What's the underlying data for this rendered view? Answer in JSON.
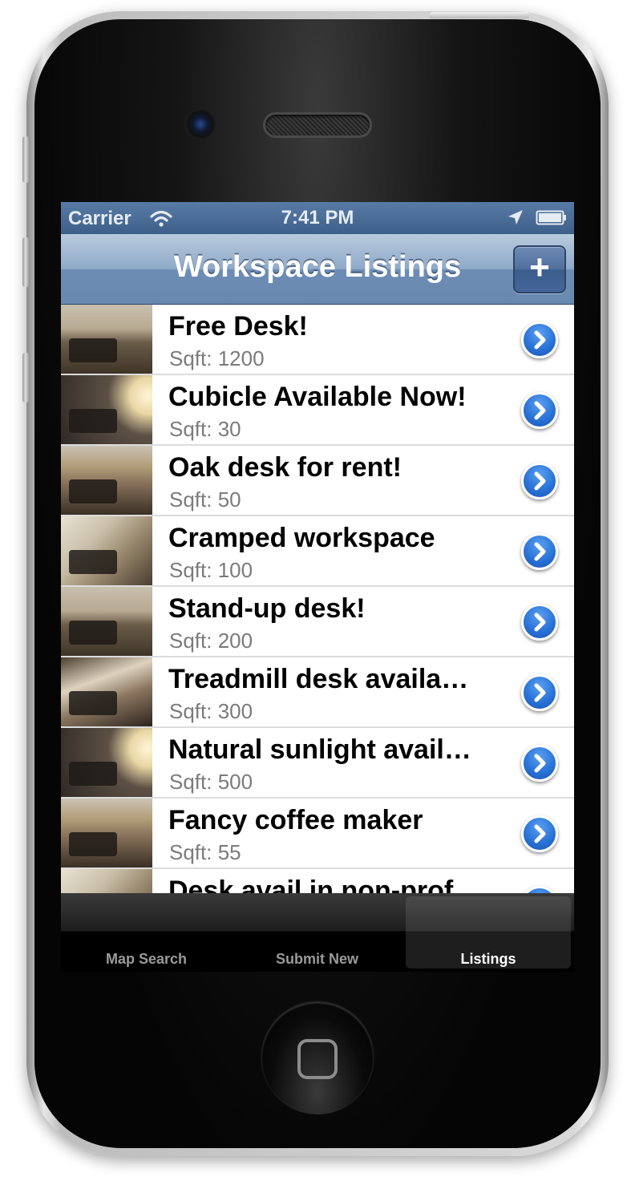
{
  "status_bar": {
    "carrier": "Carrier",
    "time": "7:41 PM",
    "icons": [
      "wifi-icon",
      "location-arrow-icon",
      "battery-icon"
    ]
  },
  "nav": {
    "title": "Workspace Listings",
    "add_label": "+"
  },
  "listings": [
    {
      "title": "Free Desk!",
      "subtitle": "Sqft: 1200"
    },
    {
      "title": "Cubicle Available Now!",
      "subtitle": "Sqft: 30"
    },
    {
      "title": "Oak desk for rent!",
      "subtitle": "Sqft: 50"
    },
    {
      "title": "Cramped workspace",
      "subtitle": "Sqft: 100"
    },
    {
      "title": "Stand-up desk!",
      "subtitle": "Sqft: 200"
    },
    {
      "title": "Treadmill desk availa…",
      "subtitle": "Sqft: 300"
    },
    {
      "title": "Natural sunlight avail…",
      "subtitle": "Sqft: 500"
    },
    {
      "title": "Fancy coffee maker",
      "subtitle": "Sqft: 55"
    },
    {
      "title": "Desk avail in non-prof…",
      "subtitle": ""
    }
  ],
  "tabs": [
    {
      "label": "Map Search",
      "active": false
    },
    {
      "label": "Submit New",
      "active": false
    },
    {
      "label": "Listings",
      "active": true
    }
  ],
  "colors": {
    "nav_bar": "#6888b0",
    "status_bar": "#3d5f89",
    "disclosure": "#2a73d8",
    "tab_bar": "#000000"
  }
}
